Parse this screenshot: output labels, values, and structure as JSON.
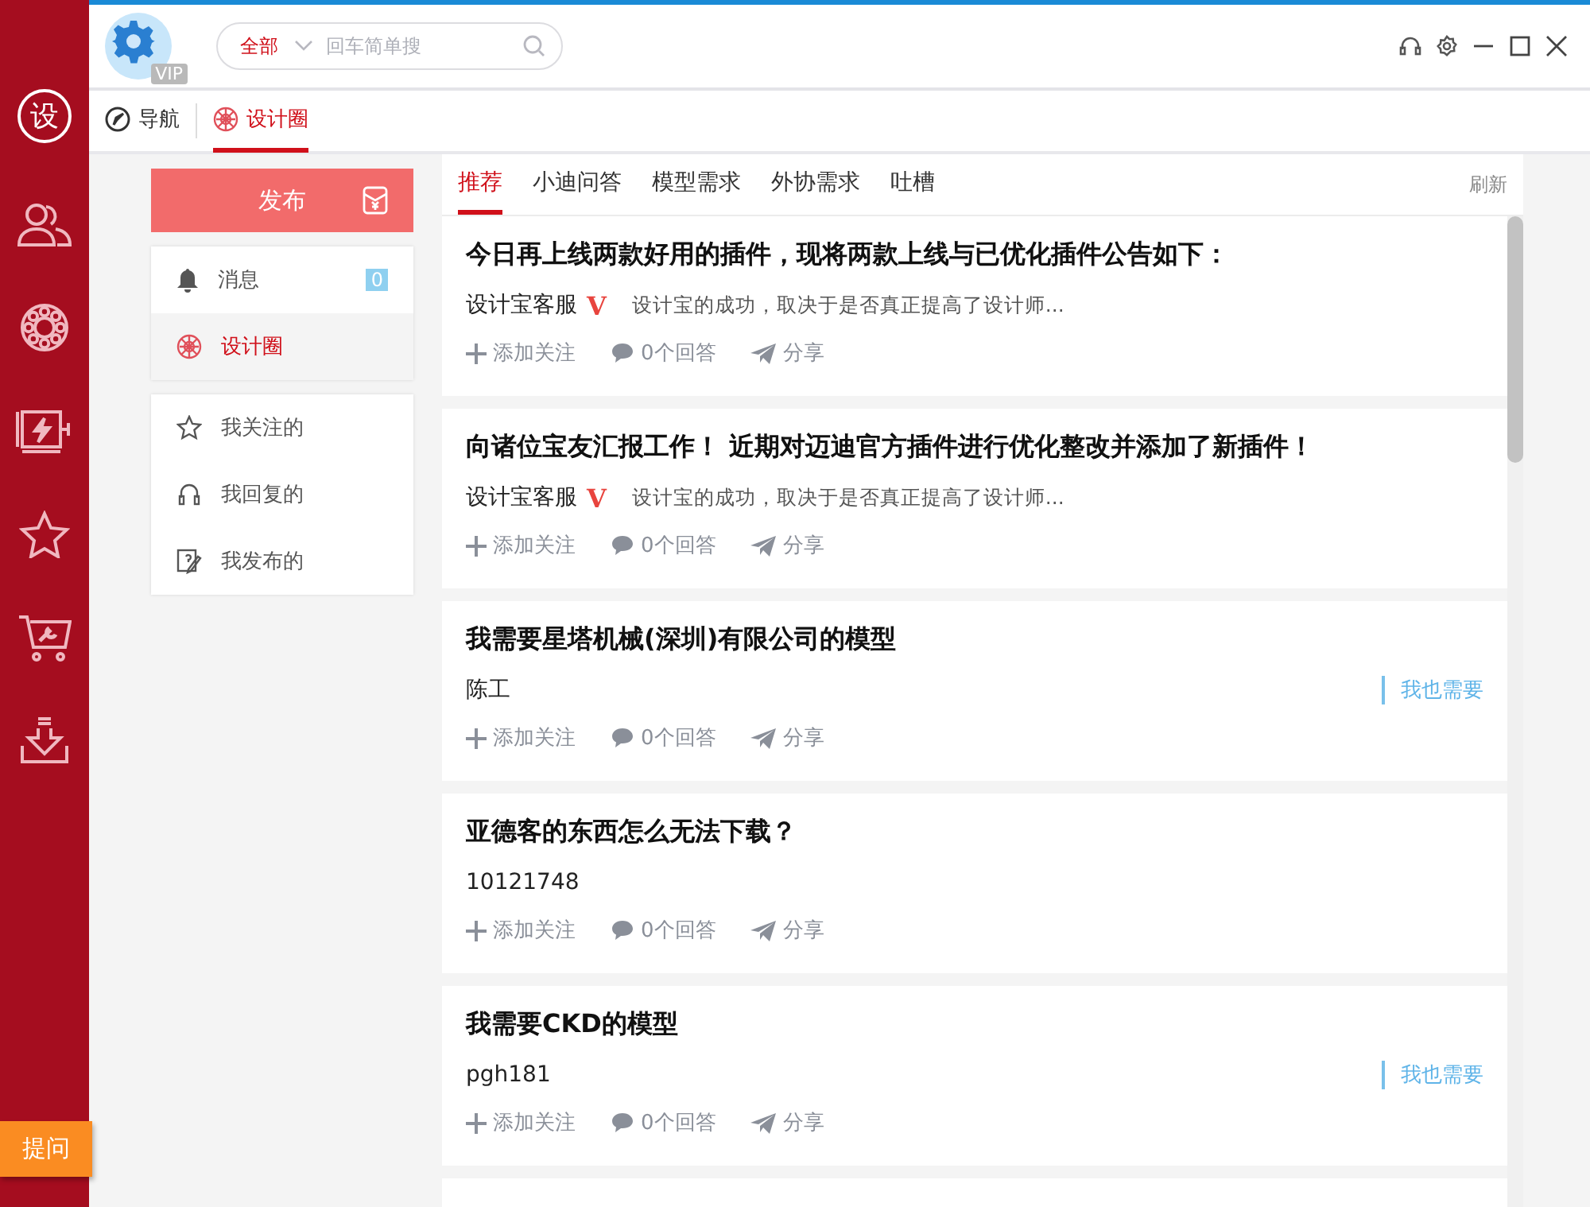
{
  "sidebar": {
    "logo": "设",
    "ask_button": "提问"
  },
  "header": {
    "vip_badge": "VIP",
    "search": {
      "scope": "全部",
      "placeholder": "回车简单搜"
    }
  },
  "nav_tabs": [
    {
      "label": "导航",
      "selected": false
    },
    {
      "label": "设计圈",
      "selected": true
    }
  ],
  "publish_button": "发布",
  "menu": [
    {
      "label": "消息",
      "badge": "0",
      "selected": false
    },
    {
      "label": "设计圈",
      "selected": true
    }
  ],
  "my_menu": [
    {
      "label": "我关注的"
    },
    {
      "label": "我回复的"
    },
    {
      "label": "我发布的"
    }
  ],
  "feed_tabs": [
    {
      "label": "推荐",
      "selected": true
    },
    {
      "label": "小迪问答",
      "selected": false
    },
    {
      "label": "模型需求",
      "selected": false
    },
    {
      "label": "外协需求",
      "selected": false
    },
    {
      "label": "吐槽",
      "selected": false
    }
  ],
  "refresh": "刷新",
  "posts": [
    {
      "title": "今日再上线两款好用的插件，现将两款上线与已优化插件公告如下：",
      "author": "设计宝客服",
      "verified_mark": "V",
      "excerpt": "设计宝的成功，取决于是否真正提高了设计师...",
      "actions": [
        "添加关注",
        "0个回答",
        "分享"
      ]
    },
    {
      "title": "向诸位宝友汇报工作！ 近期对迈迪官方插件进行优化整改并添加了新插件！",
      "author": "设计宝客服",
      "verified_mark": "V",
      "excerpt": "设计宝的成功，取决于是否真正提高了设计师...",
      "actions": [
        "添加关注",
        "0个回答",
        "分享"
      ]
    },
    {
      "title": "我需要星塔机械(深圳)有限公司的模型",
      "author": "陈工",
      "need_button": "我也需要",
      "actions": [
        "添加关注",
        "0个回答",
        "分享"
      ]
    },
    {
      "title": "亚德客的东西怎么无法下载？",
      "author": "10121748",
      "actions": [
        "添加关注",
        "0个回答",
        "分享"
      ]
    },
    {
      "title": "我需要CKD的模型",
      "author": "pgh181",
      "need_button": "我也需要",
      "actions": [
        "添加关注",
        "0个回答",
        "分享"
      ]
    }
  ]
}
